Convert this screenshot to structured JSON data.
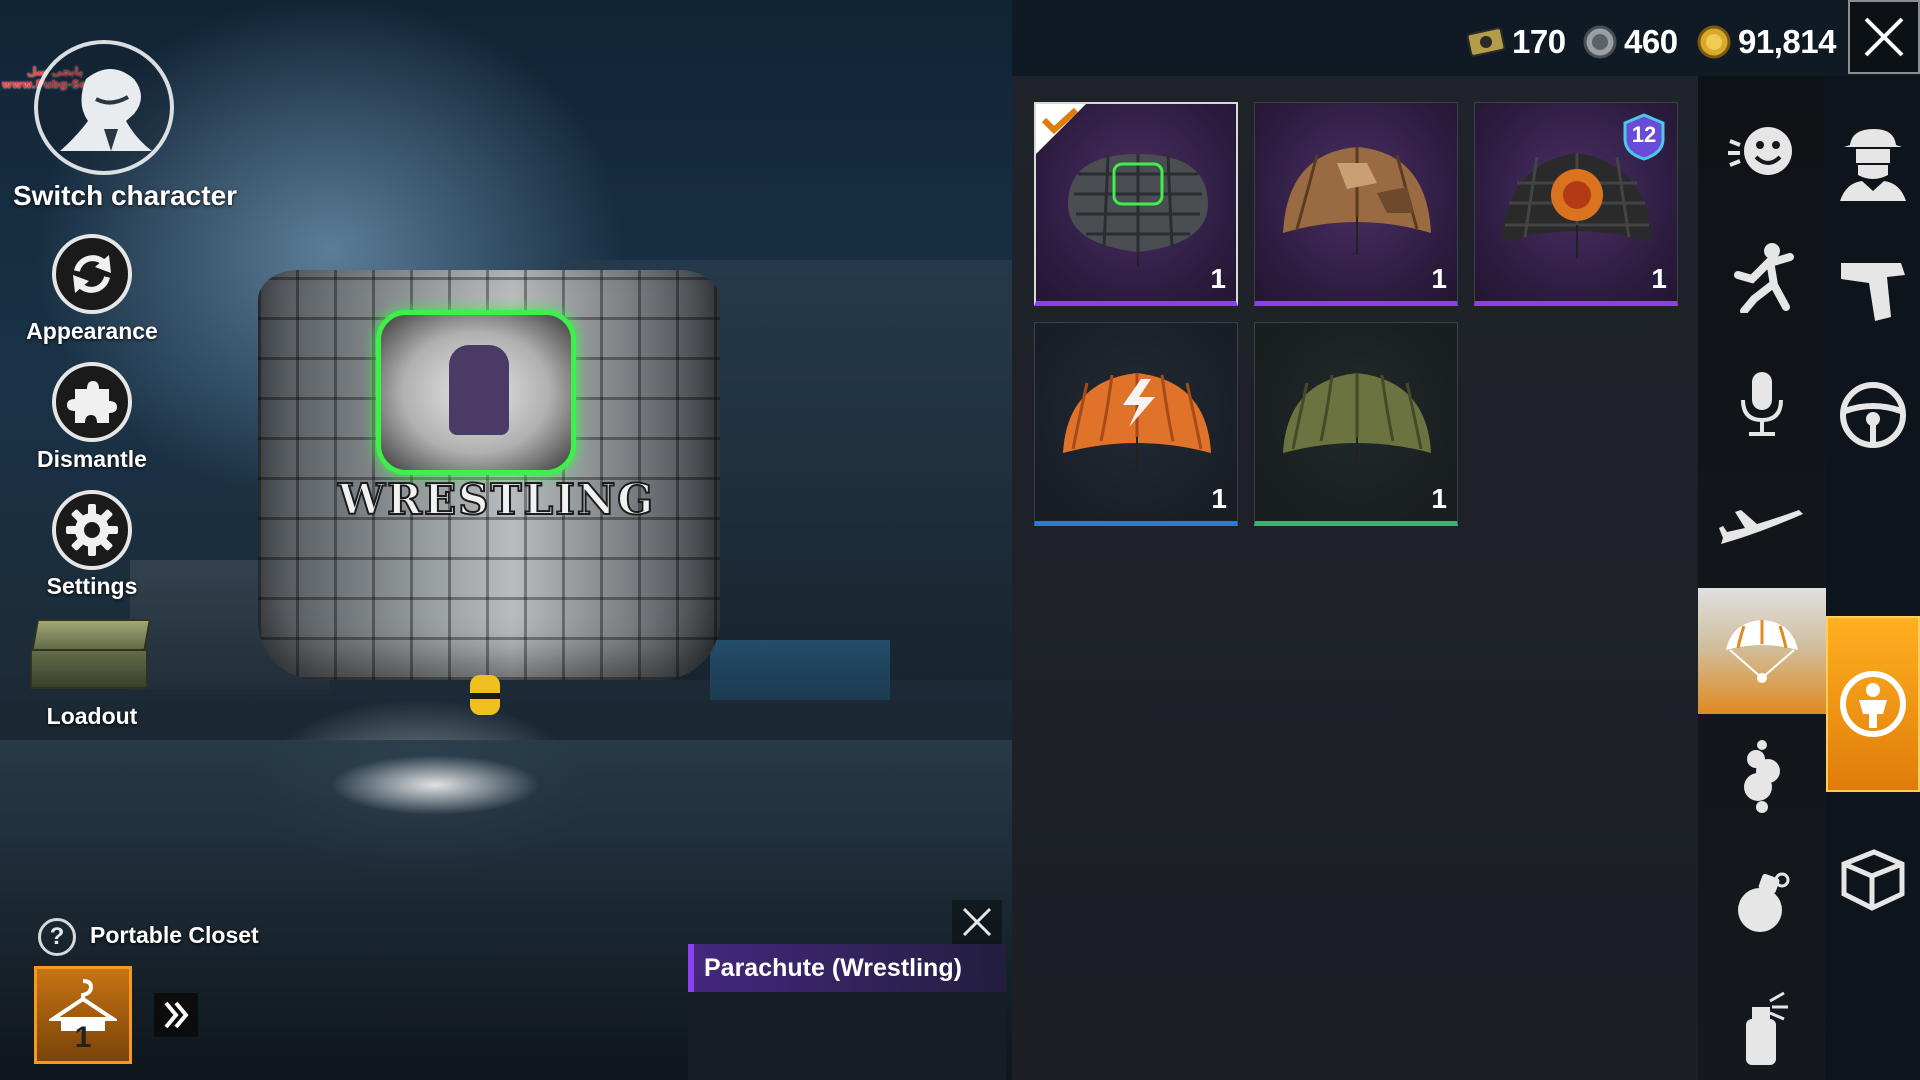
{
  "watermark": {
    "line1": "پابجی سل",
    "line2": "www.Pubg-Sell.ir"
  },
  "left_menu": {
    "switch_character_label": "Switch character",
    "appearance_label": "Appearance",
    "dismantle_label": "Dismantle",
    "settings_label": "Settings",
    "loadout_label": "Loadout"
  },
  "preview": {
    "parachute_text": "WRESTLING"
  },
  "portable_closet": {
    "help_icon": "?",
    "label": "Portable Closet",
    "slot_number": "1"
  },
  "tooltip": {
    "title": "Parachute (Wrestling)"
  },
  "currency": {
    "coupons": "170",
    "silver": "460",
    "bp": "91,814"
  },
  "items": [
    {
      "count": "1",
      "rarity_color": "#8a3ff0",
      "equipped": true,
      "icon": "wrestling-parachute-icon"
    },
    {
      "count": "1",
      "rarity_color": "#8a3ff0",
      "icon": "camo-parachute-icon"
    },
    {
      "count": "1",
      "rarity_color": "#8a3ff0",
      "level_badge": "12",
      "icon": "lion-parachute-icon"
    },
    {
      "count": "1",
      "rarity_color": "#2a7bd8",
      "icon": "orange-lightning-parachute-icon"
    },
    {
      "count": "1",
      "rarity_color": "#33b572",
      "icon": "olive-parachute-icon"
    }
  ],
  "categories": [
    "emote-icon",
    "pose-icon",
    "voice-icon",
    "plane-icon",
    "parachute-icon",
    "smoke-icon",
    "grenade-icon",
    "spray-icon"
  ],
  "active_category": "parachute-icon",
  "side_tabs": [
    "outfit-icon",
    "gun-icon",
    "vehicle-icon",
    "character-icon",
    "crate-icon"
  ],
  "active_side_tab": "character-icon",
  "colors": {
    "accent_orange": "#e07c0a",
    "rarity_purple": "#8a3ff0",
    "rarity_blue": "#2a7bd8",
    "rarity_green": "#33b572"
  }
}
